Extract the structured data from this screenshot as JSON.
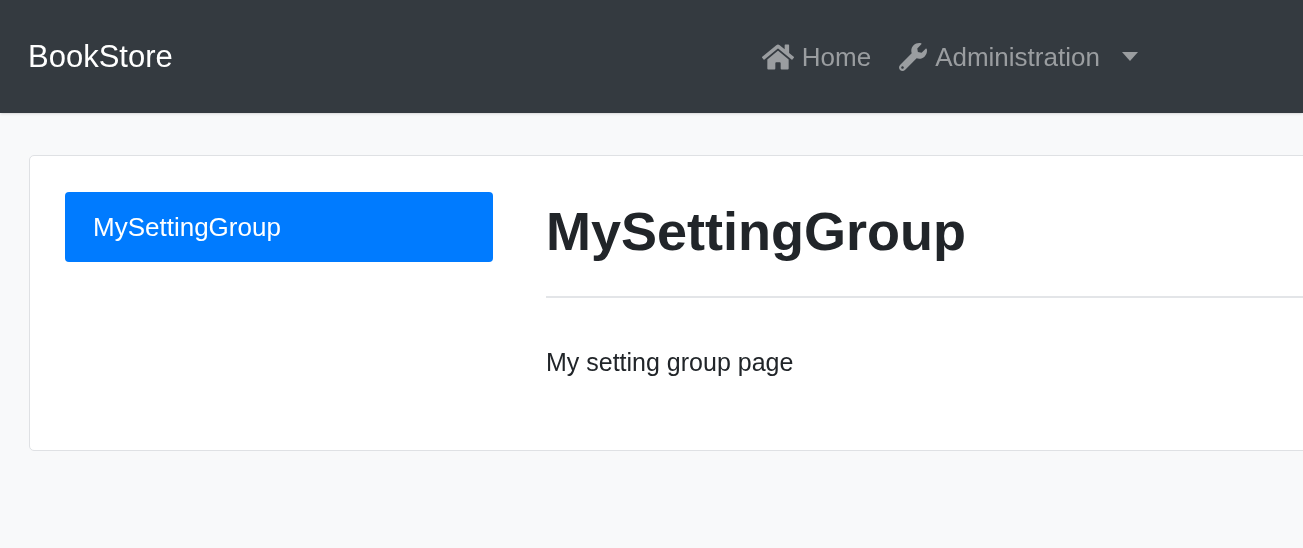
{
  "navbar": {
    "brand": "BookStore",
    "items": [
      {
        "kind": "link",
        "label": "Home"
      },
      {
        "kind": "dropdown",
        "label": "Administration"
      }
    ]
  },
  "settings": {
    "groups": [
      {
        "label": "MySettingGroup",
        "selected": true
      }
    ],
    "title": "MySettingGroup",
    "body": "My setting group page"
  }
}
